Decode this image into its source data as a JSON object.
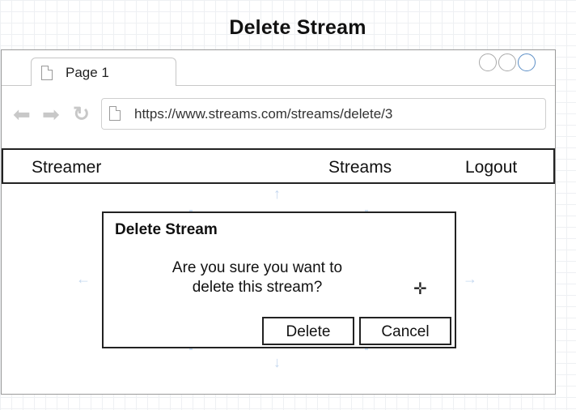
{
  "page": {
    "title": "Delete Stream"
  },
  "browser": {
    "tab_label": "Page 1",
    "url": "https://www.streams.com/streams/delete/3",
    "back_icon": "arrow-left-icon",
    "forward_icon": "arrow-right-icon",
    "reload_icon": "reload-icon"
  },
  "navbar": {
    "brand": "Streamer",
    "streams_link": "Streams",
    "logout_link": "Logout"
  },
  "modal": {
    "title": "Delete Stream",
    "message": "Are you sure you want to delete this stream?",
    "delete_label": "Delete",
    "cancel_label": "Cancel"
  },
  "colors": {
    "border": "#222222",
    "guide": "#c5d8ef",
    "window_button_accent": "#5b8ec6"
  }
}
